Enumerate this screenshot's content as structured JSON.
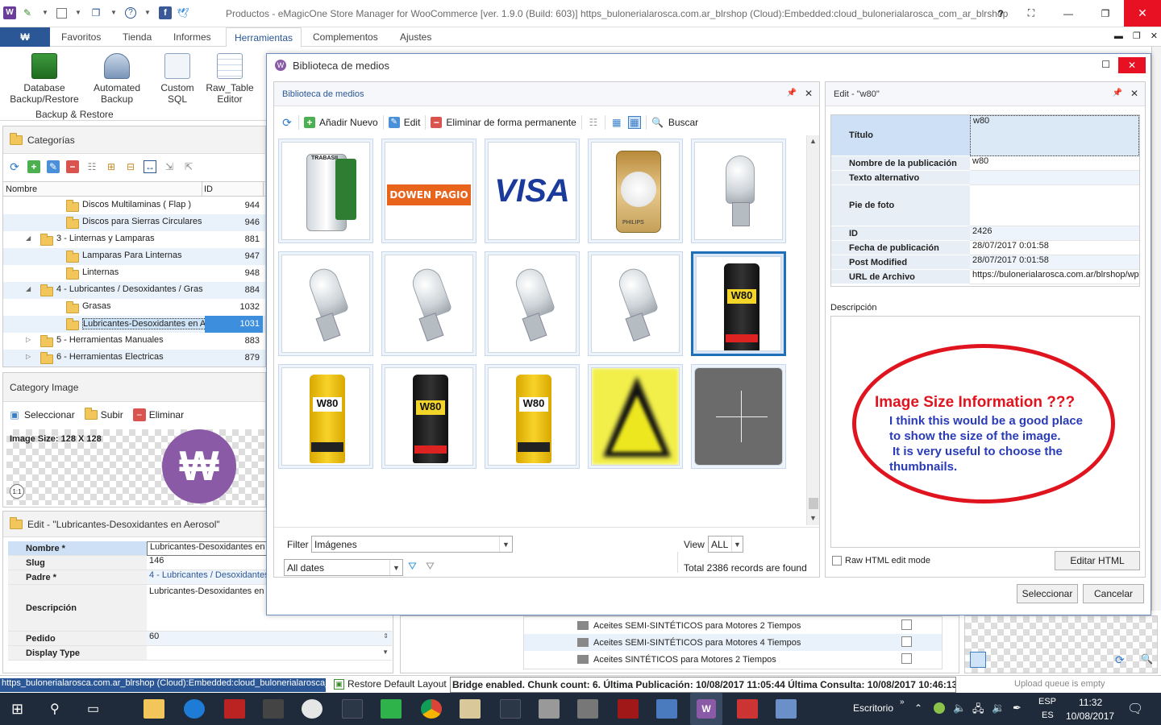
{
  "window": {
    "title": "Productos - eMagicOne Store Manager for WooCommerce [ver. 1.9.0 (Build: 603)] https_bulonerialarosca.com.ar_blrshop (Cloud):Embedded:cloud_bulonerialarosca_com_ar_blrshop",
    "help": "?"
  },
  "ribbon": {
    "tabs": [
      "Favoritos",
      "Tienda",
      "Informes",
      "Herramientas",
      "Complementos",
      "Ajustes"
    ],
    "buttons": [
      {
        "l1": "Database",
        "l2": "Backup/Restore"
      },
      {
        "l1": "Automated",
        "l2": "Backup"
      },
      {
        "l1": "Custom",
        "l2": "SQL"
      },
      {
        "l1": "Raw_Table",
        "l2": "Editor"
      }
    ],
    "group_label": "Backup & Restore"
  },
  "categories": {
    "header": "Categorías",
    "col_name": "Nombre",
    "col_id": "ID",
    "rows": [
      {
        "name": "Discos Multilaminas ( Flap )",
        "id": "944"
      },
      {
        "name": "Discos para Sierras Circulares",
        "id": "946"
      },
      {
        "name": "3 - Linternas y Lamparas",
        "id": "881"
      },
      {
        "name": "Lamparas Para Linternas",
        "id": "947"
      },
      {
        "name": "Linternas",
        "id": "948"
      },
      {
        "name": "4 - Lubricantes / Desoxidantes / Gras",
        "id": "884"
      },
      {
        "name": "Grasas",
        "id": "1032"
      },
      {
        "name": "Lubricantes-Desoxidantes en Aer",
        "id": "1031"
      },
      {
        "name": "5 - Herramientas Manuales",
        "id": "883"
      },
      {
        "name": "6 - Herramientas Electricas",
        "id": "879"
      }
    ]
  },
  "category_image": {
    "header": "Category Image",
    "select": "Seleccionar",
    "upload": "Subir",
    "delete": "Eliminar",
    "size": "Image Size: 128 X 128",
    "zoom": "1:1"
  },
  "edit_category": {
    "header": "Edit - \"Lubricantes-Desoxidantes en Aerosol\"",
    "fields": [
      {
        "k": "Nombre *",
        "v": "Lubricantes-Desoxidantes en A"
      },
      {
        "k": "Slug",
        "v": "146"
      },
      {
        "k": "Padre *",
        "v": "4 - Lubricantes / Desoxidantes"
      },
      {
        "k": "Descripción",
        "v": "Lubricantes-Desoxidantes en A"
      },
      {
        "k": "Pedido",
        "v": "60"
      },
      {
        "k": "Display Type",
        "v": ""
      }
    ]
  },
  "dialog": {
    "title": "Biblioteca de medios",
    "panel_title": "Biblioteca de medios",
    "toolbar": {
      "add": "Añadir Nuevo",
      "edit": "Edit",
      "delete": "Eliminar de forma permanente",
      "search": "Buscar"
    },
    "thumbs": [
      {
        "label": "TRABASIL",
        "kind": "bottle"
      },
      {
        "label": "DOWEN PAGIO",
        "kind": "logo"
      },
      {
        "label": "VISA",
        "kind": "visa"
      },
      {
        "label": "PHILIPS",
        "kind": "pack"
      },
      {
        "label": "",
        "kind": "bulb"
      },
      {
        "label": "",
        "kind": "bulb"
      },
      {
        "label": "",
        "kind": "bulb"
      },
      {
        "label": "",
        "kind": "bulb"
      },
      {
        "label": "",
        "kind": "bulb"
      },
      {
        "label": "W80",
        "kind": "can-dark"
      },
      {
        "label": "W80",
        "kind": "can-yellow"
      },
      {
        "label": "W80",
        "kind": "can-dark"
      },
      {
        "label": "W80",
        "kind": "can-yellow"
      },
      {
        "label": "",
        "kind": "warning"
      },
      {
        "label": "",
        "kind": "add"
      }
    ],
    "filter_label": "Filter",
    "filter_value": "Imágenes",
    "view_label": "View",
    "view_value": "ALL",
    "dates_value": "All dates",
    "records": "Total 2386 records are found",
    "select_button": "Seleccionar",
    "cancel_button": "Cancelar"
  },
  "edit_media": {
    "header": "Edit - \"w80\"",
    "fields": [
      {
        "k": "Título",
        "v": "w80"
      },
      {
        "k": "Nombre de la publicación",
        "v": "w80"
      },
      {
        "k": "Texto alternativo",
        "v": ""
      },
      {
        "k": "Pie de foto",
        "v": ""
      },
      {
        "k": "ID",
        "v": "2426"
      },
      {
        "k": "Fecha de publicación",
        "v": "28/07/2017 0:01:58"
      },
      {
        "k": "Post Modified",
        "v": "28/07/2017 0:01:58"
      },
      {
        "k": "URL de Archivo",
        "v": "https://bulonerialarosca.com.ar/blrshop/wp"
      }
    ],
    "desc_label": "Descripción",
    "raw_html": "Raw HTML edit mode",
    "edit_html": "Editar HTML",
    "annotation": {
      "title": "Image Size Information ???",
      "lines": [
        "I think this would be a good place",
        "to show the size of the image.",
        "It is very useful to choose the",
        "thumbnails."
      ]
    }
  },
  "background_list": {
    "rows": [
      "Aceites SEMI-SINTÉTICOS para Motores 2 Tiempos",
      "Aceites SEMI-SINTÉTICOS para Motores 4 Tiempos",
      "Aceites SINTÉTICOS para Motores 2 Tiempos"
    ]
  },
  "statusbar": {
    "conn": "https_bulonerialarosca.com.ar_blrshop (Cloud):Embedded:cloud_bulonerialarosca_",
    "restore": "Restore Default Layout",
    "bridge": "Bridge enabled. Chunk count: 6. Última Publicación: 10/08/2017 11:05:44 Última Consulta: 10/08/2017 10:46:13",
    "queue": "Upload queue is empty"
  },
  "taskbar": {
    "desktop": "Escritorio",
    "lang1": "ESP",
    "lang2": "ES",
    "time": "11:32",
    "date": "10/08/2017"
  },
  "colors": {
    "accent": "#2b5797",
    "selection": "#3d8fde",
    "annotation_red": "#e0141e",
    "annotation_blue": "#2a3bb8",
    "woo_purple": "#8a5aa6"
  }
}
